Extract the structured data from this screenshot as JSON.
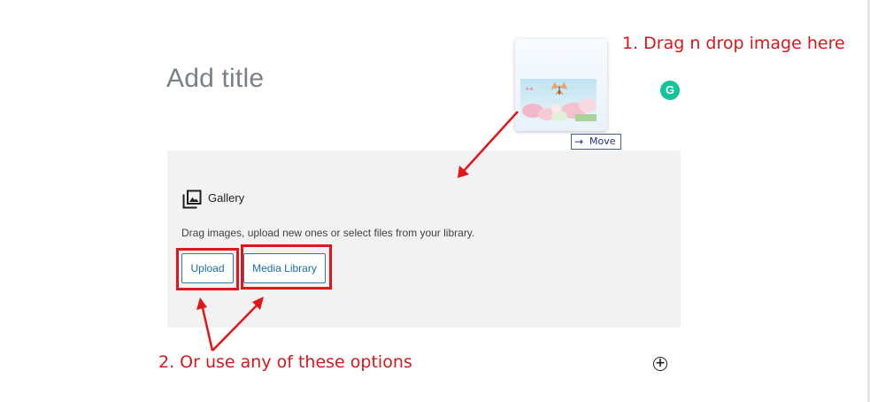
{
  "editor": {
    "title_placeholder": "Add title"
  },
  "drag_preview": {
    "move_label": "Move",
    "arrow_glyph": "→"
  },
  "gallery": {
    "label": "Gallery",
    "description": "Drag images, upload new ones or select files from your library.",
    "upload_label": "Upload",
    "media_library_label": "Media Library"
  },
  "annotations": {
    "note_1": "1. Drag n drop image here",
    "note_2": "2. Or use any of these options",
    "color": "#e0161b"
  },
  "icons": {
    "grammarly": "G",
    "add_block": "+"
  },
  "colors": {
    "button_border": "#2c7eb0",
    "button_text": "#1a6fa5",
    "block_bg": "#f2f2f2",
    "grammarly": "#15c39a"
  }
}
